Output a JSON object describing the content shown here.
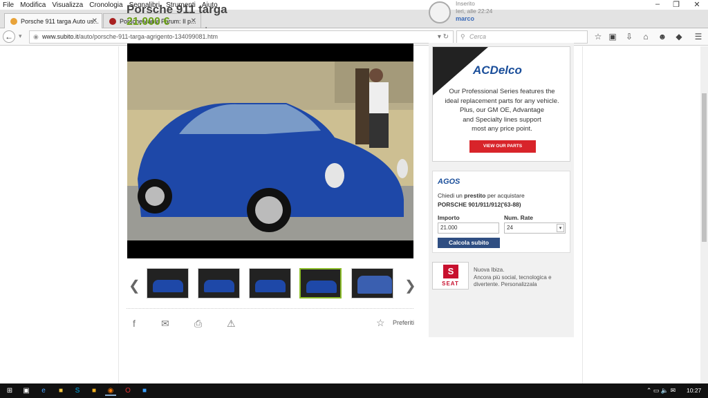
{
  "browser": {
    "menu": [
      "File",
      "Modifica",
      "Visualizza",
      "Cronologia",
      "Segnalibri",
      "Strumenti",
      "Aiuto"
    ],
    "tabs": [
      {
        "label": "Porsche 911 targa Auto us...",
        "color": "#e8a33a"
      },
      {
        "label": "PorscheMania Forum: Il p...",
        "color": "#a82020"
      }
    ],
    "url_host": "www.subito.it",
    "url_path": "/auto/porsche-911-targa-agrigento-134099081.htm",
    "search_placeholder": "Cerca"
  },
  "listing": {
    "title": "Porsche 911 targa",
    "price": "21.000 €",
    "seller_meta_1": "Inserito",
    "seller_meta_2": "Ieri, alle 22:24",
    "seller_name": "marco",
    "thumbnail_count": 5,
    "selected_thumbnail": 4,
    "favorites_label": "Preferiti"
  },
  "ads": {
    "acdelco_brand": "ACDelco",
    "acdelco_copy_1": "Our Professional Series features the",
    "acdelco_copy_2": "ideal replacement parts for any vehicle.",
    "acdelco_copy_3": "Plus, our GM OE, Advantage",
    "acdelco_copy_4": "and Specialty lines support",
    "acdelco_copy_5": "most any price point.",
    "acdelco_cta": "VIEW OUR PARTS",
    "agos_logo": "AGOS",
    "agos_q_pre": "Chiedi un ",
    "agos_q_bold": "prestito",
    "agos_q_post": " per acquistare",
    "agos_model": "PORSCHE 901/911/912('63-88)",
    "agos_importo_label": "Importo",
    "agos_importo_value": "21.000",
    "agos_rate_label": "Num. Rate",
    "agos_rate_value": "24",
    "agos_button": "Calcola subito",
    "seat_logo_word": "SEAT",
    "seat_line_1": "Nuova Ibiza.",
    "seat_line_2": "Ancora più social, tecnologica e",
    "seat_line_3": "divertente. Personalizzala"
  },
  "taskbar": {
    "clock": "10:27"
  }
}
